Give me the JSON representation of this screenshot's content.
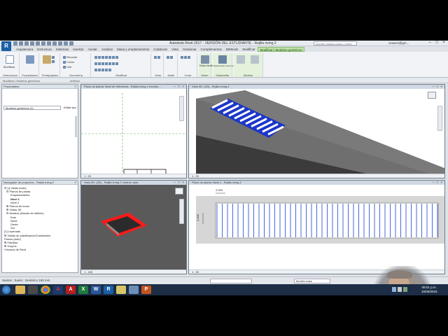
{
  "window": {
    "title": "Autodesk Revit 2017 - VERSIÓN DEL ESTUDIANTE - Rejilla irving 2",
    "search_placeholder": "Escribir palabra clave o frase",
    "user": "cesarrs@gm...",
    "app_letter": "R"
  },
  "ribbon_tabs": [
    "Arquitectura",
    "Estructura",
    "Sistemas",
    "Insertar",
    "Anotar",
    "Analizar",
    "Masa y emplazamiento",
    "Colaborar",
    "Vista",
    "Gestionar",
    "Complementos",
    "BIMtools",
    "Modificar",
    "Modificar | Modelos genéricos"
  ],
  "ribbon_panels": {
    "seleccionar": "Seleccionar",
    "modificar_btn": "Modificar",
    "propiedades": "Propiedades",
    "portapapeles": "Portapapeles",
    "geometria": "Geometría",
    "modificar": "Modificar",
    "vista": "Vista",
    "medir": "Medir",
    "crear": "Crear",
    "modo": "Modo",
    "subfamilia": "Subfamilia",
    "modelo": "Modelo",
    "pegar": "Pegar",
    "recortar": "Recortar",
    "cortar": "Cortar",
    "unir": "Unir",
    "editar_familia": "Editar familia",
    "seleccionar_nuevo_anfitrion": "Seleccionar nuevo anfitrión",
    "modelo_cortado": "Modelo cortado",
    "modelo_en_sitio": "Modelo in situ"
  },
  "options_bar": {
    "left": "Modificar | Modelos genéricos",
    "center": "anfitrión"
  },
  "properties": {
    "title": "Propiedades",
    "type": "Modelos genéricos (1)",
    "edit_type": "Editar tipo"
  },
  "project_browser": {
    "title": "Navegador de proyectos - Rejilla irving 2",
    "items": [
      {
        "label": "⊟ [•] Vistas (todo)",
        "indent": 0,
        "bold": false
      },
      {
        "label": "⊟ Planos de planta",
        "indent": 1,
        "bold": false
      },
      {
        "label": "Emplazamiento",
        "indent": 3,
        "bold": false
      },
      {
        "label": "Nivel 1",
        "indent": 3,
        "bold": true
      },
      {
        "label": "Nivel 2",
        "indent": 3,
        "bold": false
      },
      {
        "label": "⊞ Planos de techo",
        "indent": 1,
        "bold": false
      },
      {
        "label": "⊞ Vistas 3D",
        "indent": 1,
        "bold": false
      },
      {
        "label": "⊟ Alzados (Alzado de edificio)",
        "indent": 1,
        "bold": false
      },
      {
        "label": "Este",
        "indent": 3,
        "bold": false
      },
      {
        "label": "Norte",
        "indent": 3,
        "bold": false
      },
      {
        "label": "Oeste",
        "indent": 3,
        "bold": false
      },
      {
        "label": "Sur",
        "indent": 3,
        "bold": false
      },
      {
        "label": "[≡] Leyendas",
        "indent": 0,
        "bold": false
      },
      {
        "label": "⊞ Tablas de planificación/Cantidades",
        "indent": 0,
        "bold": false
      },
      {
        "label": "Planos (todo)",
        "indent": 0,
        "bold": false
      },
      {
        "label": "⊞ Familias",
        "indent": 0,
        "bold": false
      },
      {
        "label": "⊞ Grupos",
        "indent": 0,
        "bold": false
      },
      {
        "label": "Vínculos de Revit",
        "indent": 0,
        "bold": false
      }
    ]
  },
  "viewports": {
    "plan_ref": {
      "title": "Plano de planta: Nivel de referencia - Rejilla irving 2 modulo ...",
      "scale": "1 : 20"
    },
    "view3d_top": {
      "title": "Vista 3D: {3D} - Rejilla irving 2",
      "scale": "1 : 20"
    },
    "view3d_bottom": {
      "title": "Vista 3D: {3D} - Rejilla irving 2 modulo vado",
      "scale": "1 : 100"
    },
    "plan_level1": {
      "title": "Plano de planta: Nivel 1 - Rejilla irving 2",
      "scale": "1 : 20",
      "dim_top": "2,000",
      "dim_left": "2,000"
    }
  },
  "status": {
    "message": "Suelos : Suelo : Genérico 150 mm",
    "model": ":0",
    "base": "Modelo base"
  },
  "taskbar": {
    "time": "09:01 p.m.",
    "date": "15/06/2016",
    "apps": [
      "explorer",
      "media",
      "chrome",
      "acrobat-alt",
      "autocad",
      "excel",
      "word",
      "revit",
      "files",
      "explorer2",
      "powerpoint"
    ]
  },
  "colors": {
    "ribbon_ctx": "#bfe3a9",
    "brand": "#1a5fa8",
    "selection_red": "#ff0000",
    "grate_blue": "#2b50d8"
  }
}
